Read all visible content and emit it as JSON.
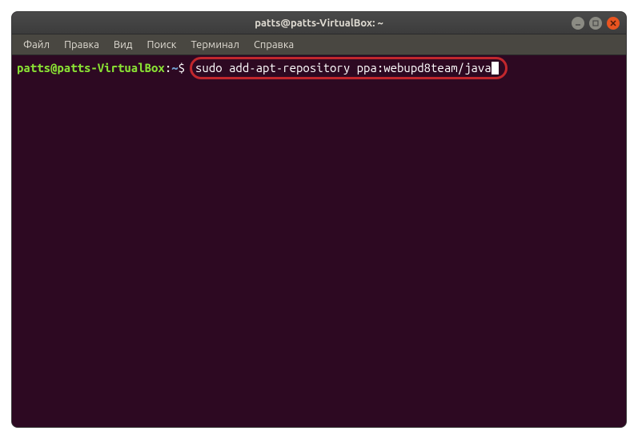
{
  "window": {
    "title": "patts@patts-VirtualBox: ~"
  },
  "menubar": {
    "items": [
      {
        "label": "Файл"
      },
      {
        "label": "Правка"
      },
      {
        "label": "Вид"
      },
      {
        "label": "Поиск"
      },
      {
        "label": "Терминал"
      },
      {
        "label": "Справка"
      }
    ]
  },
  "terminal": {
    "prompt_user": "patts@patts-VirtualBox",
    "prompt_colon": ":",
    "prompt_path": "~",
    "prompt_dollar": "$",
    "command": "sudo add-apt-repository ppa:webupd8team/java"
  }
}
